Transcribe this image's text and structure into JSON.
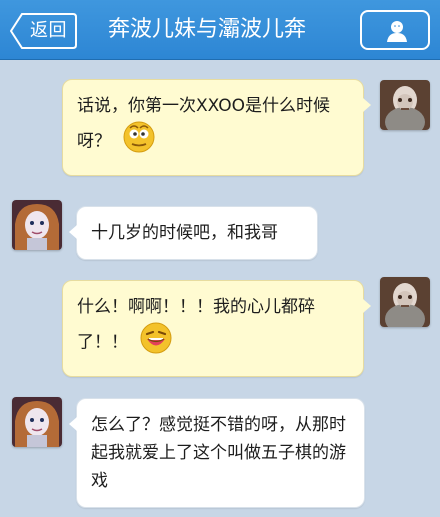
{
  "header": {
    "back_label": "返回",
    "title": "奔波儿妹与灞波儿奔",
    "profile_icon": "person-icon"
  },
  "messages": [
    {
      "side": "right",
      "text": "话说，你第一次XXOO是什么时候呀？",
      "emoji": "curious-face"
    },
    {
      "side": "left",
      "text": "十几岁的时候吧，和我哥"
    },
    {
      "side": "right",
      "text": "什么！啊啊！！！我的心儿都碎了！！",
      "emoji": "laughing-face"
    },
    {
      "side": "left",
      "text": "怎么了？感觉挺不错的呀，从那时起我就爱上了这个叫做五子棋的游戏"
    }
  ],
  "colors": {
    "header": "#2d86d4",
    "background": "#c7d6e6",
    "sent_bubble": "#fffbd1",
    "received_bubble": "#ffffff"
  }
}
